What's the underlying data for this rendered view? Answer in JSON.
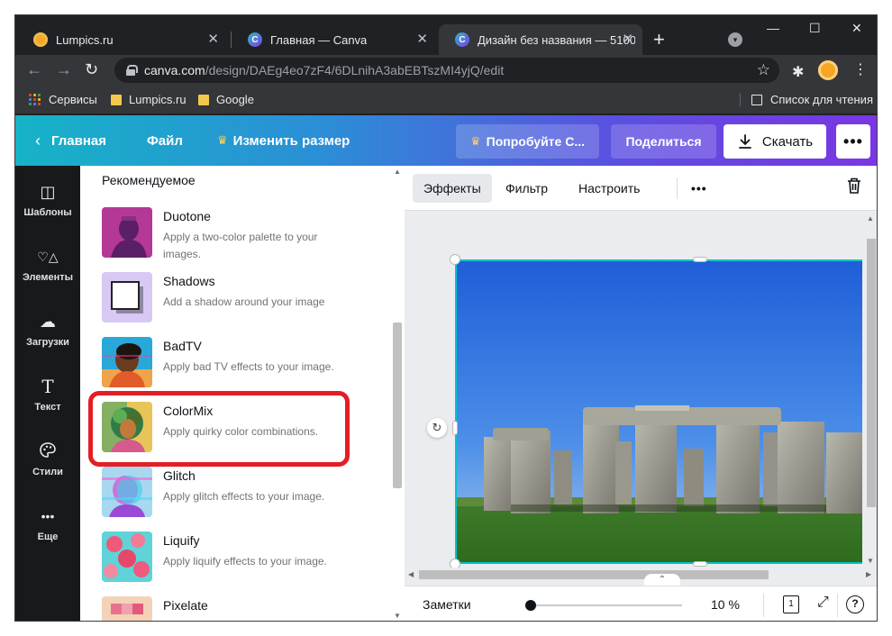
{
  "browser": {
    "tabs": [
      {
        "title": "Lumpics.ru",
        "favicon": "lumpics-icon"
      },
      {
        "title": "Главная — Canva",
        "favicon": "canva-icon"
      },
      {
        "title": "Дизайн без названия — 5100",
        "favicon": "canva-icon",
        "active": true
      }
    ],
    "favicon_letter": "C",
    "new_tab": "+",
    "tab_close": "✕",
    "window_controls": {
      "minimize": "—",
      "maximize": "☐",
      "close": "✕"
    },
    "url_host": "canva.com",
    "url_path": "/design/DAEg4eo7zF4/6DLnihA3abEBTszMI4yjQ/edit",
    "bookmarks": [
      "Сервисы",
      "Lumpics.ru",
      "Google"
    ],
    "reading_list": "Список для чтения"
  },
  "canva_header": {
    "home": "Главная",
    "file": "Файл",
    "resize": "Изменить размер",
    "try_pro": "Попробуйте С...",
    "share": "Поделиться",
    "download": "Скачать",
    "more": "•••"
  },
  "rail": [
    {
      "label": "Шаблоны",
      "icon": "templates-icon",
      "glyph": "◫"
    },
    {
      "label": "Элементы",
      "icon": "elements-icon",
      "glyph": "♡△"
    },
    {
      "label": "Загрузки",
      "icon": "upload-icon",
      "glyph": "☁"
    },
    {
      "label": "Текст",
      "icon": "text-icon",
      "glyph": "T"
    },
    {
      "label": "Стили",
      "icon": "styles-icon",
      "glyph": "🎨"
    },
    {
      "label": "Еще",
      "icon": "more-icon",
      "glyph": "•••"
    }
  ],
  "effects_panel": {
    "heading": "Рекомендуемое",
    "effects": [
      {
        "name": "Duotone",
        "desc": "Apply a two-color palette to your images."
      },
      {
        "name": "Shadows",
        "desc": "Add a shadow around your image"
      },
      {
        "name": "BadTV",
        "desc": "Apply bad TV effects to your image."
      },
      {
        "name": "ColorMix",
        "desc": "Apply quirky color combinations."
      },
      {
        "name": "Glitch",
        "desc": "Apply glitch effects to your image."
      },
      {
        "name": "Liquify",
        "desc": "Apply liquify effects to your image."
      },
      {
        "name": "Pixelate",
        "desc": ""
      }
    ]
  },
  "editor": {
    "tabs": [
      "Эффекты",
      "Фильтр",
      "Настроить"
    ],
    "more": "•••",
    "notes": "Заметки",
    "zoom": "10 %",
    "page": "1",
    "help": "?"
  }
}
